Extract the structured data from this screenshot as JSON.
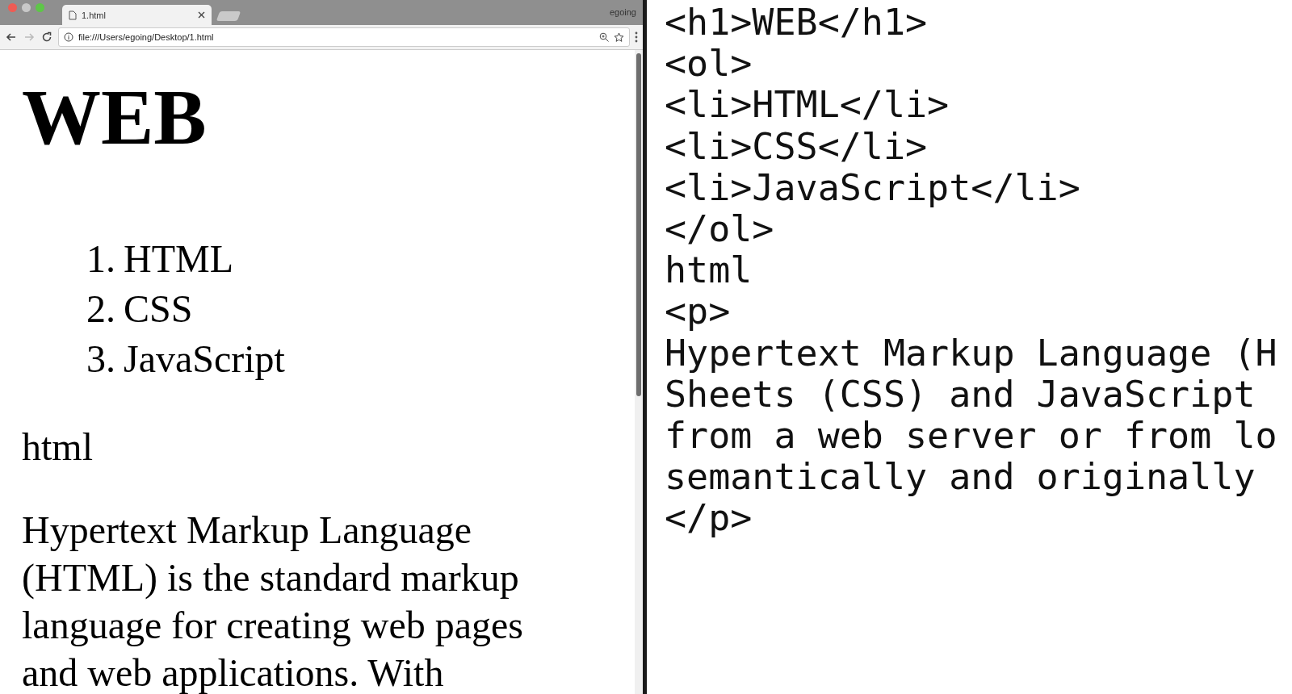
{
  "browser": {
    "tab_title": "1.html",
    "profile": "egoing",
    "url": "file:///Users/egoing/Desktop/1.html"
  },
  "page": {
    "heading": "WEB",
    "list": [
      {
        "number": "1.",
        "text": "HTML"
      },
      {
        "number": "2.",
        "text": "CSS"
      },
      {
        "number": "3.",
        "text": "JavaScript"
      }
    ],
    "text": "html",
    "paragraph_lines": [
      "Hypertext Markup Language",
      "(HTML) is the standard markup",
      "language for creating web pages",
      "and web applications. With"
    ]
  },
  "editor": {
    "lines": [
      "<h1>WEB</h1>",
      "<ol>",
      "<li>HTML</li>",
      "<li>CSS</li>",
      "<li>JavaScript</li>",
      "</ol>",
      "html",
      "<p>",
      "Hypertext Markup Language (H",
      "Sheets (CSS) and JavaScript",
      "from a web server or from lo",
      "semantically and originally",
      "</p>"
    ]
  }
}
